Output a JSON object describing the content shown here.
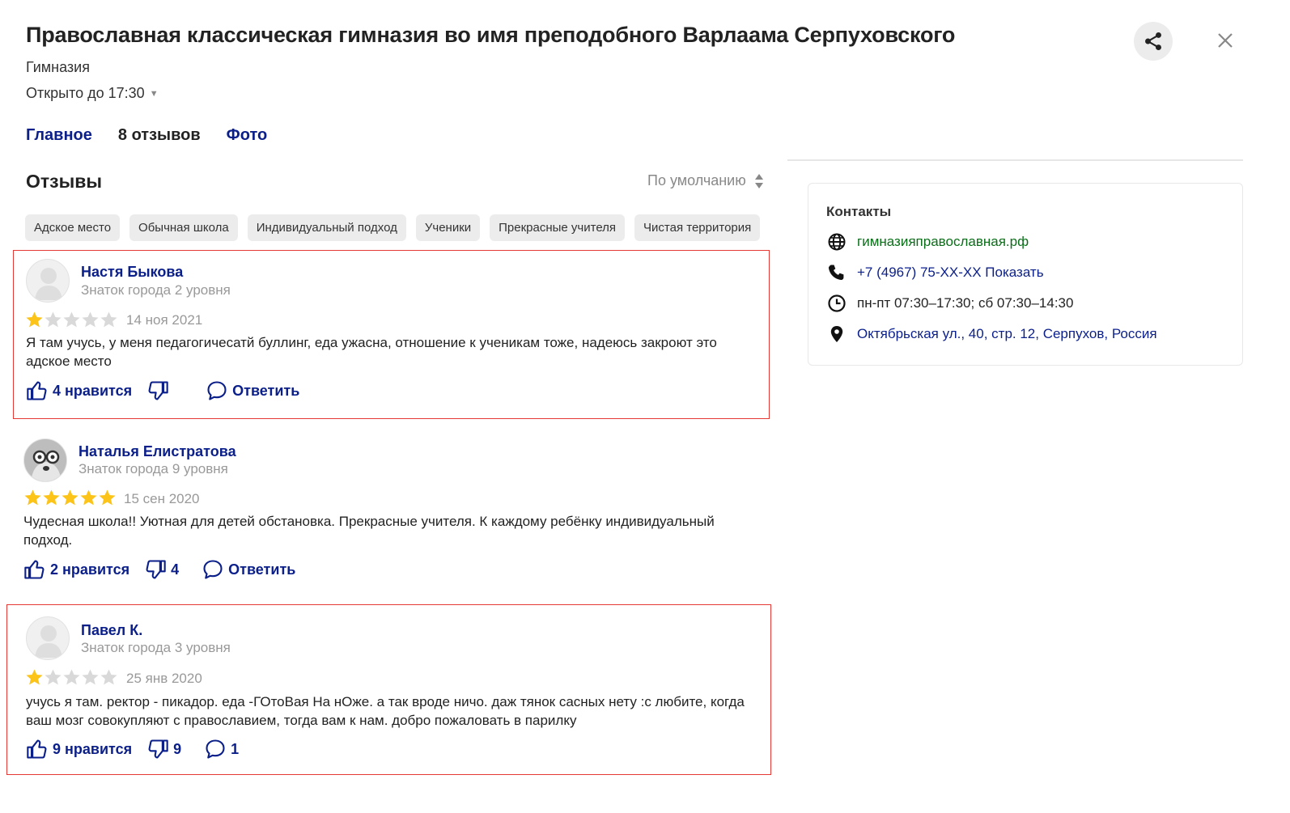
{
  "header": {
    "title": "Православная классическая гимназия во имя преподобного Варлаама Серпуховского",
    "category": "Гимназия",
    "hours_status": "Открыто до 17:30",
    "hours_caret": "▼"
  },
  "tabs": [
    {
      "label": "Главное"
    },
    {
      "label": "8 отзывов"
    },
    {
      "label": "Фото"
    }
  ],
  "reviews_section": {
    "heading": "Отзывы",
    "sort_label": "По умолчанию",
    "tags": [
      "Адское место",
      "Обычная школа",
      "Индивидуальный подход",
      "Ученики",
      "Прекрасные учителя",
      "Чистая территория"
    ]
  },
  "reviews": [
    {
      "author": "Настя Быкова",
      "level": "Знаток города 2 уровня",
      "rating": 1,
      "date": "14 ноя 2021",
      "text": "Я там учусь, у меня педагогичесатй буллинг, еда ужасна, отношение к ученикам тоже, надеюсь закроют это адское место",
      "likes_label": "4 нравится",
      "dislikes_count": "",
      "reply_label": "Ответить"
    },
    {
      "author": "Наталья Елистратова",
      "level": "Знаток города 9 уровня",
      "rating": 5,
      "date": "15 сен 2020",
      "text": "Чудесная школа!! Уютная для детей обстановка. Прекрасные учителя. К каждому ребёнку индивидуальный подход.",
      "likes_label": "2 нравится",
      "dislikes_count": "4",
      "reply_label": "Ответить"
    },
    {
      "author": "Павел К.",
      "level": "Знаток города 3 уровня",
      "rating": 1,
      "date": "25 янв 2020",
      "text": "учусь я там. ректор - пикадор. еда -ГОтоВая На нОже. а так вроде ничо. даж тянок сасных нету :с любите, когда ваш мозг совокупляют с православием, тогда вам к нам. добро пожаловать в парилку",
      "likes_label": "9 нравится",
      "dislikes_count": "9",
      "reply_label": "1"
    }
  ],
  "contacts": {
    "title": "Контакты",
    "website": "гимназияправославная.рф",
    "phone": "+7 (4967) 75-XX-XX Показать",
    "hours": "пн-пт 07:30–17:30; сб 07:30–14:30",
    "address": "Октябрьская ул., 40, стр. 12, Серпухов, Россия"
  },
  "icons": {
    "share": "share-icon",
    "close": "close-icon",
    "sort": "sort-icon",
    "like": "thumbs-up-icon",
    "dislike": "thumbs-down-icon",
    "reply": "comment-icon",
    "website": "globe-icon",
    "phone": "phone-icon",
    "hours": "clock-icon",
    "address": "location-pin-icon"
  },
  "colors": {
    "link": "#0b1f8a",
    "star_filled": "#fcc419",
    "star_empty": "#d9d9d9",
    "highlight_border": "#e53935",
    "website": "#0a6e18"
  }
}
